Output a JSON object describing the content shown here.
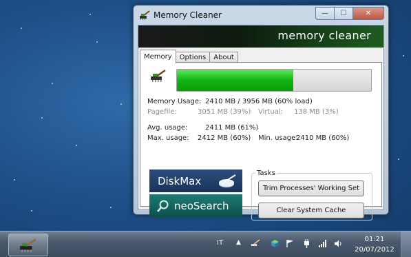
{
  "window": {
    "title": "Memory Cleaner",
    "banner_text": "memory cleaner",
    "controls": {
      "minimize": "—",
      "maximize": "☐",
      "close": "✕"
    }
  },
  "tabs": [
    {
      "label": "Memory",
      "active": true
    },
    {
      "label": "Options",
      "active": false
    },
    {
      "label": "About",
      "active": false
    }
  ],
  "memory": {
    "usage_fraction": 0.6,
    "usage_label": "Memory Usage:",
    "usage_value": "2410 MB / 3956 MB  (60% load)",
    "pagefile_label": "Pagefile:",
    "pagefile_value": "3051 MB (39%)",
    "virtual_label": "Virtual:",
    "virtual_value": "138 MB (3%)",
    "avg_label": "Avg. usage:",
    "avg_value": "2411 MB (61%)",
    "max_label": "Max. usage:",
    "max_value": "2412 MB (60%)",
    "min_label": "Min. usage:",
    "min_value": "2410 MB (60%)"
  },
  "ads": {
    "diskmax": "DiskMax",
    "neosearch": "neoSearch"
  },
  "tasks": {
    "group_label": "Tasks",
    "trim_button": "Trim Processes' Working Set",
    "clear_button": "Clear System Cache"
  },
  "taskbar": {
    "language": "IT",
    "time": "01:21",
    "date": "20/07/2012"
  },
  "colors": {
    "progress_green": "#12b412",
    "banner_green": "#1f5c22"
  }
}
